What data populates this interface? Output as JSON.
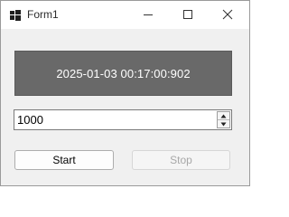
{
  "window": {
    "title": "Form1",
    "icons": {
      "app": "windows-form-icon",
      "minimize": "minimize-icon",
      "maximize": "maximize-icon",
      "close": "close-icon"
    }
  },
  "clock": {
    "display_text": "2025-01-03 00:17:00:902",
    "background_color": "#696969",
    "text_color": "#ffffff"
  },
  "interval": {
    "value": "1000",
    "icons": {
      "up": "chevron-up-icon",
      "down": "chevron-down-icon"
    }
  },
  "buttons": {
    "start_label": "Start",
    "stop_label": "Stop",
    "stop_enabled": false
  }
}
